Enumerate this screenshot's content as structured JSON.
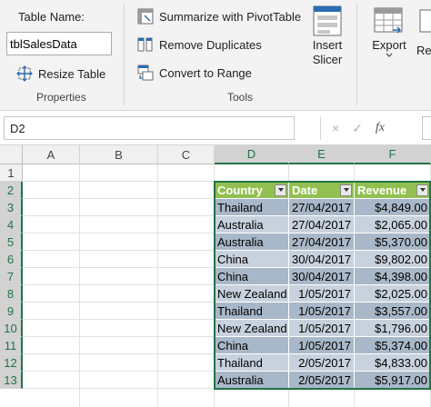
{
  "ribbon": {
    "table_name_label": "Table Name:",
    "table_name_value": "tblSalesData",
    "resize_table_label": "Resize Table",
    "properties_group_label": "Properties",
    "summarize_label": "Summarize with PivotTable",
    "remove_duplicates_label": "Remove Duplicates",
    "convert_to_range_label": "Convert to Range",
    "tools_group_label": "Tools",
    "insert_slicer_line1": "Insert",
    "insert_slicer_line2": "Slicer",
    "export_label": "Export",
    "refresh_partial": "Re"
  },
  "formula_bar": {
    "name_box": "D2",
    "cancel_icon": "×",
    "enter_icon": "✓",
    "fx_label": "fx"
  },
  "columns": [
    "A",
    "B",
    "C",
    "D",
    "E",
    "F"
  ],
  "rows": [
    "1",
    "2",
    "3",
    "4",
    "5",
    "6",
    "7",
    "8",
    "9",
    "10",
    "11",
    "12",
    "13"
  ],
  "table": {
    "headers": [
      "Country",
      "Date",
      "Revenue"
    ],
    "rows": [
      [
        "Thailand",
        "27/04/2017",
        "$4,849.00"
      ],
      [
        "Australia",
        "27/04/2017",
        "$2,065.00"
      ],
      [
        "Australia",
        "27/04/2017",
        "$5,370.00"
      ],
      [
        "China",
        "30/04/2017",
        "$9,802.00"
      ],
      [
        "China",
        "30/04/2017",
        "$4,398.00"
      ],
      [
        "New Zealand",
        "1/05/2017",
        "$2,025.00"
      ],
      [
        "Thailand",
        "1/05/2017",
        "$3,557.00"
      ],
      [
        "New Zealand",
        "1/05/2017",
        "$1,796.00"
      ],
      [
        "China",
        "1/05/2017",
        "$5,374.00"
      ],
      [
        "Thailand",
        "2/05/2017",
        "$4,833.00"
      ],
      [
        "Australia",
        "2/05/2017",
        "$5,917.00"
      ]
    ]
  },
  "colors": {
    "header_fill": "#92c050",
    "band_dark": "#a9b8c9",
    "band_light": "#c8d2de",
    "selection": "#217346"
  }
}
